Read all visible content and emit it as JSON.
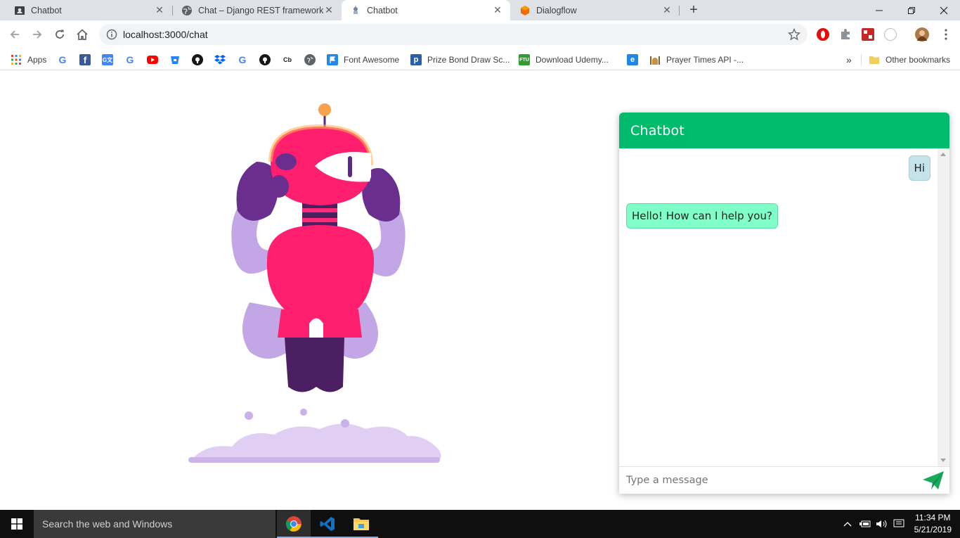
{
  "browser": {
    "tabs": [
      {
        "title": "Chatbot",
        "icon": "contact-card-icon"
      },
      {
        "title": "Chat – Django REST framework",
        "icon": "globe-icon"
      },
      {
        "title": "Chatbot",
        "icon": "robot-favicon-icon"
      },
      {
        "title": "Dialogflow",
        "icon": "dialogflow-icon"
      }
    ],
    "new_tab_label": "+",
    "url": "localhost:3000/chat",
    "bookmarks": [
      {
        "label": "Apps",
        "icon": "apps-grid-icon"
      },
      {
        "label": "",
        "icon": "google-icon"
      },
      {
        "label": "",
        "icon": "facebook-icon"
      },
      {
        "label": "",
        "icon": "google-translate-icon"
      },
      {
        "label": "",
        "icon": "google-icon"
      },
      {
        "label": "",
        "icon": "youtube-icon"
      },
      {
        "label": "",
        "icon": "bitbucket-icon"
      },
      {
        "label": "",
        "icon": "github-icon"
      },
      {
        "label": "",
        "icon": "dropbox-icon"
      },
      {
        "label": "",
        "icon": "google-icon"
      },
      {
        "label": "",
        "icon": "github-icon"
      },
      {
        "label": "Cb",
        "icon": "crunchbase-icon"
      },
      {
        "label": "",
        "icon": "globe-icon"
      },
      {
        "label": "Font Awesome",
        "icon": "flag-icon"
      },
      {
        "label": "Prize Bond Draw Sc...",
        "icon": "p-icon"
      },
      {
        "label": "Download Udemy...",
        "icon": "ftu-icon"
      },
      {
        "label": "",
        "icon": "e-icon"
      },
      {
        "label": "Prayer Times API -...",
        "icon": "mosque-icon"
      }
    ],
    "more_bookmarks": "»",
    "other_bookmarks": "Other bookmarks"
  },
  "chat": {
    "title": "Chatbot",
    "messages": [
      {
        "from": "user",
        "text": "Hi"
      },
      {
        "from": "bot",
        "text": "Hello! How can I help you?"
      }
    ],
    "input_placeholder": "Type a message",
    "send_icon": "paper-plane-icon",
    "colors": {
      "header": "#00bb6b",
      "user_bubble": "#c5e3ea",
      "bot_bubble": "#7fffc7",
      "send": "#1aaa5e"
    }
  },
  "taskbar": {
    "search_placeholder": "Search the web and Windows",
    "time": "11:34 PM",
    "date": "5/21/2019"
  }
}
